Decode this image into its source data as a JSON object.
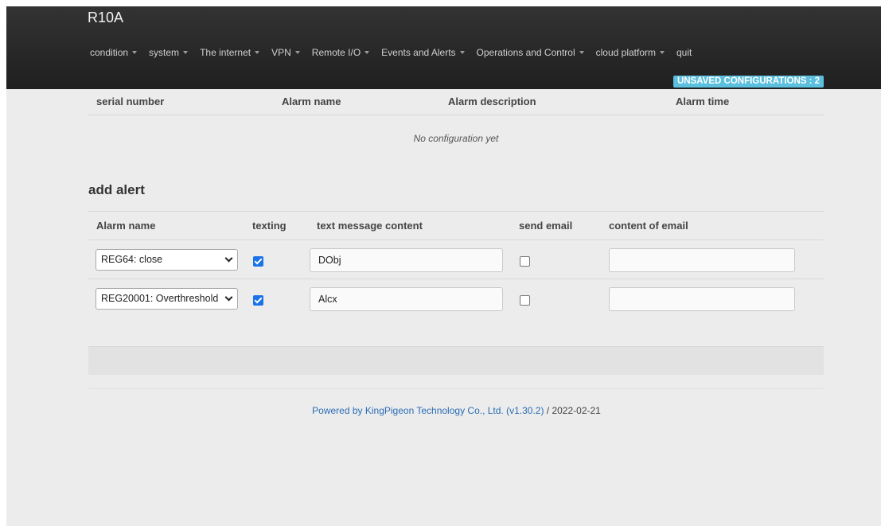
{
  "app": {
    "title": "R10A"
  },
  "nav": {
    "items": [
      {
        "label": "condition",
        "dropdown": true
      },
      {
        "label": "system",
        "dropdown": true
      },
      {
        "label": "The internet",
        "dropdown": true
      },
      {
        "label": "VPN",
        "dropdown": true
      },
      {
        "label": "Remote I/O",
        "dropdown": true
      },
      {
        "label": "Events and Alerts",
        "dropdown": true
      },
      {
        "label": "Operations and Control",
        "dropdown": true
      },
      {
        "label": "cloud platform",
        "dropdown": true
      },
      {
        "label": "quit",
        "dropdown": false
      }
    ],
    "unsaved_badge": "UNSAVED CONFIGURATIONS : 2"
  },
  "alarm_table": {
    "headers": [
      "serial number",
      "Alarm name",
      "Alarm description",
      "Alarm time"
    ],
    "empty_text": "No configuration yet"
  },
  "add_alert": {
    "title": "add alert",
    "headers": [
      "Alarm name",
      "texting",
      "text message content",
      "send email",
      "content of email"
    ],
    "rows": [
      {
        "alarm": "REG64: close",
        "texting": true,
        "sms_content": "DObj",
        "send_email": false,
        "email_content": ""
      },
      {
        "alarm": "REG20001: Overthreshold",
        "texting": true,
        "sms_content": "Alcx",
        "send_email": false,
        "email_content": ""
      }
    ]
  },
  "footer": {
    "link_text": "Powered by KingPigeon Technology Co., Ltd. (v1.30.2)",
    "date_text": " / 2022-02-21"
  },
  "colors": {
    "navbar": "#222222",
    "badge": "#5bc0de",
    "link": "#2a6db5",
    "checkbox": "#1a73e8"
  }
}
